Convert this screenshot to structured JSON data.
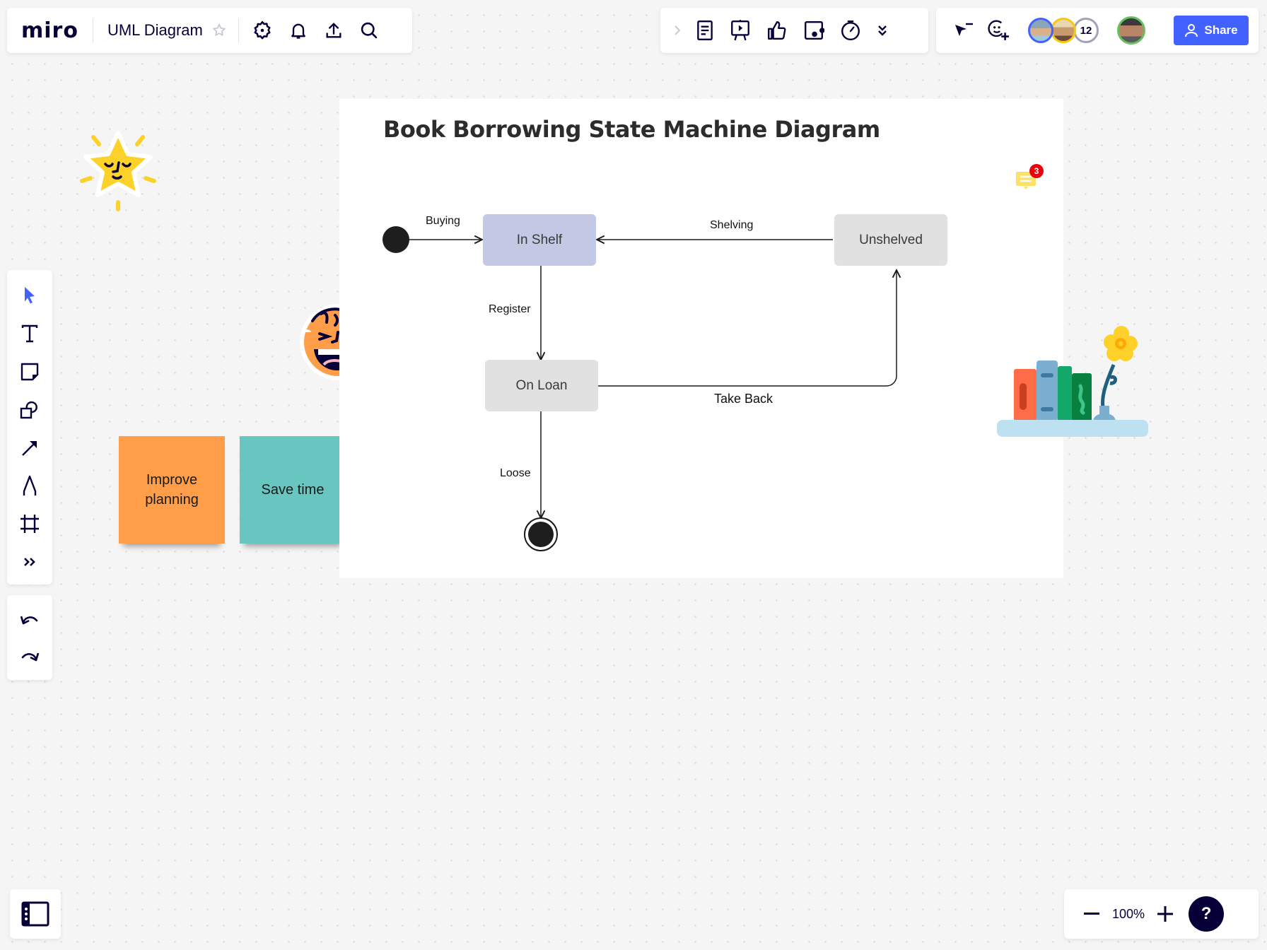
{
  "app": {
    "logo": "miro",
    "board_title": "UML Diagram",
    "accent_color": "#4262ff"
  },
  "top_left_toolbar": {
    "icons": [
      "star-icon",
      "settings-icon",
      "bell-icon",
      "export-icon",
      "search-icon"
    ]
  },
  "top_center_toolbar": {
    "icons": [
      "chevron-right-icon",
      "notes-icon",
      "presentation-icon",
      "thumbs-up-icon",
      "video-card-icon",
      "timer-icon",
      "more-chevrons-icon"
    ]
  },
  "top_right_toolbar": {
    "collaborators_count": "12",
    "share_label": "Share",
    "avatar_ring_colors": [
      "#4262ff",
      "#fac710",
      "#a3a1b5",
      "#65c15e"
    ]
  },
  "left_toolbar": {
    "tools": [
      "select",
      "text",
      "sticky-note",
      "shapes",
      "line-arrow",
      "pen",
      "frame",
      "more"
    ],
    "active_tool": "select"
  },
  "history": {
    "undo": "undo",
    "redo": "redo"
  },
  "zoom": {
    "level": "100%",
    "minus": "−",
    "plus": "+",
    "help": "?"
  },
  "diagram": {
    "title": "Book Borrowing State Machine Diagram",
    "states": [
      {
        "id": "in_shelf",
        "label": "In Shelf",
        "color": "#c3c8e4"
      },
      {
        "id": "unshelved",
        "label": "Unshelved",
        "color": "#c3c8e4"
      },
      {
        "id": "on_loan",
        "label": "On Loan",
        "color": "#e1e1e1"
      }
    ],
    "transitions": [
      {
        "from": "initial",
        "to": "in_shelf",
        "label": "Buying"
      },
      {
        "from": "unshelved",
        "to": "in_shelf",
        "label": "Shelving"
      },
      {
        "from": "in_shelf",
        "to": "on_loan",
        "label": "Register"
      },
      {
        "from": "on_loan",
        "to": "unshelved",
        "label": "Take Back"
      },
      {
        "from": "on_loan",
        "to": "final",
        "label": "Loose"
      }
    ],
    "comment_count": "3"
  },
  "stickies": [
    {
      "text": "Improve planning",
      "color": "#ff9d48"
    },
    {
      "text": "Save time",
      "color": "#67c6c0"
    }
  ]
}
